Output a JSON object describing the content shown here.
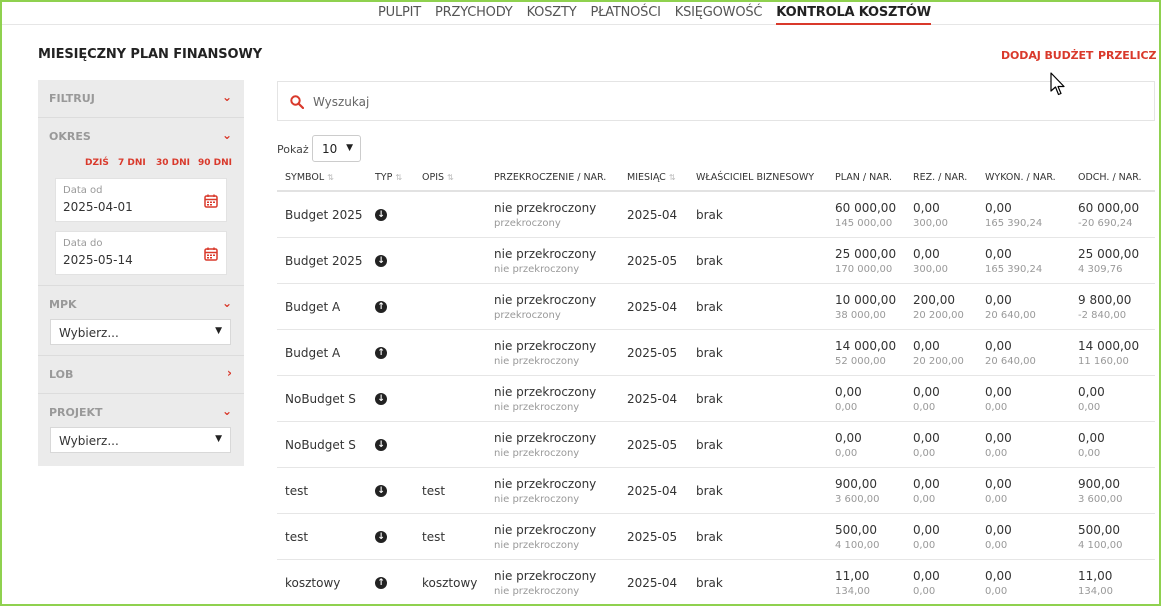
{
  "nav": {
    "items": [
      "PULPIT",
      "PRZYCHODY",
      "KOSZTY",
      "PŁATNOŚCI",
      "KSIĘGOWOŚĆ",
      "KONTROLA KOSZTÓW"
    ],
    "active": "KONTROLA KOSZTÓW"
  },
  "page": {
    "title": "MIESIĘCZNY PLAN FINANSOWY",
    "add_budget": "DODAJ BUDŻET",
    "recalc": "PRZELICZ"
  },
  "sidebar": {
    "filter": "FILTRUJ",
    "period": "OKRES",
    "quick": [
      "DZIŚ",
      "7 DNI",
      "30 DNI",
      "90 DNI"
    ],
    "date_from_label": "Data od",
    "date_from": "2025-04-01",
    "date_to_label": "Data do",
    "date_to": "2025-05-14",
    "mpk": "MPK",
    "mpk_select": "Wybierz...",
    "lob": "LOB",
    "project": "PROJEKT",
    "project_select": "Wybierz..."
  },
  "search": {
    "placeholder": "Wyszukaj"
  },
  "paging": {
    "label": "Pokaż",
    "value": "10"
  },
  "table": {
    "headers": [
      "SYMBOL",
      "TYP",
      "OPIS",
      "PRZEKROCZENIE / NAR.",
      "MIESIĄC",
      "WŁAŚCICIEL BIZNESOWY",
      "PLAN / NAR.",
      "REZ. / NAR.",
      "WYKON. / NAR.",
      "ODCH. / NAR."
    ],
    "rows": [
      {
        "symbol": "Budget 2025",
        "type": "down",
        "opis": "",
        "przekr": "nie przekroczony",
        "przekr_nar": "przekroczony",
        "miesiac": "2025-04",
        "wlasciciel": "brak",
        "plan": "60 000,00",
        "plan_nar": "145 000,00",
        "rez": "0,00",
        "rez_nar": "300,00",
        "wyk": "0,00",
        "wyk_nar": "165 390,24",
        "odch": "60 000,00",
        "odch_nar": "-20 690,24"
      },
      {
        "symbol": "Budget 2025",
        "type": "down",
        "opis": "",
        "przekr": "nie przekroczony",
        "przekr_nar": "nie przekroczony",
        "miesiac": "2025-05",
        "wlasciciel": "brak",
        "plan": "25 000,00",
        "plan_nar": "170 000,00",
        "rez": "0,00",
        "rez_nar": "300,00",
        "wyk": "0,00",
        "wyk_nar": "165 390,24",
        "odch": "25 000,00",
        "odch_nar": "4 309,76"
      },
      {
        "symbol": "Budget A",
        "type": "up",
        "opis": "",
        "przekr": "nie przekroczony",
        "przekr_nar": "przekroczony",
        "miesiac": "2025-04",
        "wlasciciel": "brak",
        "plan": "10 000,00",
        "plan_nar": "38 000,00",
        "rez": "200,00",
        "rez_nar": "20 200,00",
        "wyk": "0,00",
        "wyk_nar": "20 640,00",
        "odch": "9 800,00",
        "odch_nar": "-2 840,00"
      },
      {
        "symbol": "Budget A",
        "type": "up",
        "opis": "",
        "przekr": "nie przekroczony",
        "przekr_nar": "nie przekroczony",
        "miesiac": "2025-05",
        "wlasciciel": "brak",
        "plan": "14 000,00",
        "plan_nar": "52 000,00",
        "rez": "0,00",
        "rez_nar": "20 200,00",
        "wyk": "0,00",
        "wyk_nar": "20 640,00",
        "odch": "14 000,00",
        "odch_nar": "11 160,00"
      },
      {
        "symbol": "NoBudget S",
        "type": "down",
        "opis": "",
        "przekr": "nie przekroczony",
        "przekr_nar": "nie przekroczony",
        "miesiac": "2025-04",
        "wlasciciel": "brak",
        "plan": "0,00",
        "plan_nar": "0,00",
        "rez": "0,00",
        "rez_nar": "0,00",
        "wyk": "0,00",
        "wyk_nar": "0,00",
        "odch": "0,00",
        "odch_nar": "0,00"
      },
      {
        "symbol": "NoBudget S",
        "type": "down",
        "opis": "",
        "przekr": "nie przekroczony",
        "przekr_nar": "nie przekroczony",
        "miesiac": "2025-05",
        "wlasciciel": "brak",
        "plan": "0,00",
        "plan_nar": "0,00",
        "rez": "0,00",
        "rez_nar": "0,00",
        "wyk": "0,00",
        "wyk_nar": "0,00",
        "odch": "0,00",
        "odch_nar": "0,00"
      },
      {
        "symbol": "test",
        "type": "down",
        "opis": "test",
        "przekr": "nie przekroczony",
        "przekr_nar": "nie przekroczony",
        "miesiac": "2025-04",
        "wlasciciel": "brak",
        "plan": "900,00",
        "plan_nar": "3 600,00",
        "rez": "0,00",
        "rez_nar": "0,00",
        "wyk": "0,00",
        "wyk_nar": "0,00",
        "odch": "900,00",
        "odch_nar": "3 600,00"
      },
      {
        "symbol": "test",
        "type": "down",
        "opis": "test",
        "przekr": "nie przekroczony",
        "przekr_nar": "nie przekroczony",
        "miesiac": "2025-05",
        "wlasciciel": "brak",
        "plan": "500,00",
        "plan_nar": "4 100,00",
        "rez": "0,00",
        "rez_nar": "0,00",
        "wyk": "0,00",
        "wyk_nar": "0,00",
        "odch": "500,00",
        "odch_nar": "4 100,00"
      },
      {
        "symbol": "kosztowy",
        "type": "up",
        "opis": "kosztowy",
        "przekr": "nie przekroczony",
        "przekr_nar": "nie przekroczony",
        "miesiac": "2025-04",
        "wlasciciel": "brak",
        "plan": "11,00",
        "plan_nar": "134,00",
        "rez": "0,00",
        "rez_nar": "0,00",
        "wyk": "0,00",
        "wyk_nar": "0,00",
        "odch": "11,00",
        "odch_nar": "134,00"
      }
    ]
  },
  "colors": {
    "accent": "#d9392b",
    "sidebar_bg": "#ebebeb",
    "frame": "#8fd14f"
  }
}
